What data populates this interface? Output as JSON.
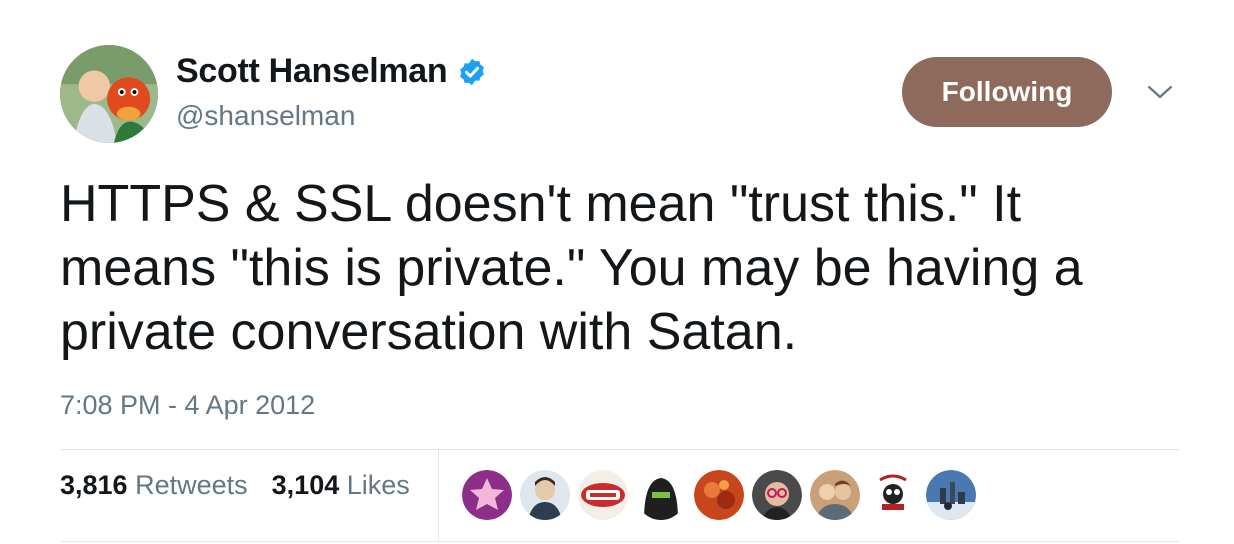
{
  "author": {
    "display_name": "Scott Hanselman",
    "handle": "@shanselman",
    "verified": true,
    "avatar_icon": "profile-photo"
  },
  "follow_button": {
    "label": "Following",
    "color": "#8d6a5c"
  },
  "tweet": {
    "text": "HTTPS & SSL doesn't mean \"trust this.\" It means \"this is private.\" You may be having a private conversation with Satan.",
    "timestamp": "7:08 PM - 4 Apr 2012"
  },
  "stats": {
    "retweets_count": "3,816",
    "retweets_label": "Retweets",
    "likes_count": "3,104",
    "likes_label": "Likes"
  },
  "liker_avatars": [
    {
      "icon": "avatar-purple-star",
      "color": "#8c2e8a"
    },
    {
      "icon": "avatar-man-beard",
      "color": "#e5c9a8"
    },
    {
      "icon": "avatar-miller-time",
      "color": "#c82c2c"
    },
    {
      "icon": "avatar-hooded-figure",
      "color": "#1f1f1f"
    },
    {
      "icon": "avatar-red-orange",
      "color": "#c8461e"
    },
    {
      "icon": "avatar-glasses",
      "color": "#4a4a4a"
    },
    {
      "icon": "avatar-couple",
      "color": "#c9a07a"
    },
    {
      "icon": "avatar-gas-mask-logo",
      "color": "#b22222"
    },
    {
      "icon": "avatar-city-skyline",
      "color": "#4a78b0"
    }
  ],
  "colors": {
    "text_primary": "#14171a",
    "text_secondary": "#657786",
    "verified_blue": "#1da1f2",
    "divider": "#e1e8ed"
  }
}
